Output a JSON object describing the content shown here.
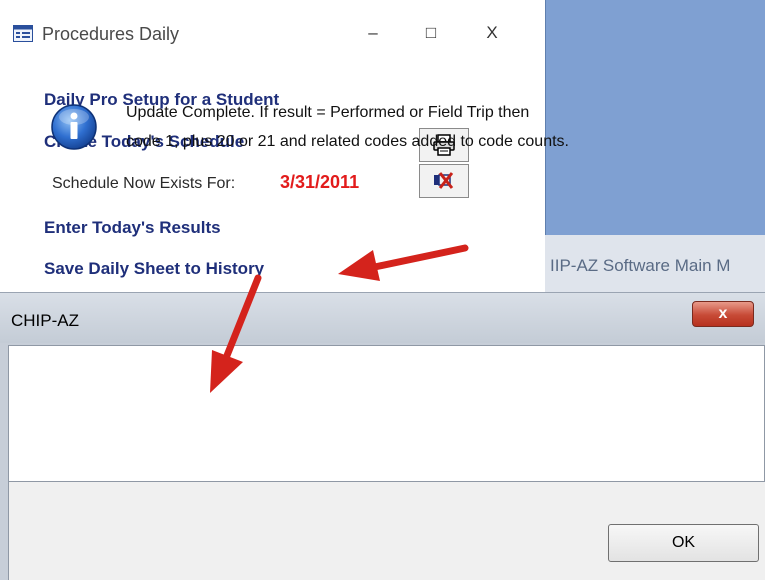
{
  "procedures_window": {
    "title": "Procedures Daily",
    "title_icon": "form-icon",
    "controls": {
      "minimize": "–",
      "maximize": "□",
      "close": "X"
    },
    "links": {
      "setup": "Daily Pro Setup for a Student",
      "create": "Create Today's Schedule",
      "enter": "Enter Today's Results",
      "save": "Save Daily Sheet to History"
    },
    "schedule_label": "Schedule Now Exists For:",
    "schedule_date": "3/31/2011",
    "buttons": [
      {
        "icon": "printer-icon"
      },
      {
        "icon": "delete-schedule-icon"
      }
    ]
  },
  "main_menu": {
    "title": "IIP-AZ Software Main M"
  },
  "dialog": {
    "title": "CHIP-AZ",
    "close_label": "x",
    "icon": "info-icon",
    "message_line_1": "Update Complete. If result = Performed or Field Trip then",
    "message_line_2": "code 1, plus 20 or 21 and related codes added to code counts.",
    "ok_label": "OK"
  },
  "colors": {
    "link": "#1f2f7a",
    "date": "#e21b1b",
    "arrow": "#d4231c",
    "blue_pane": "#7fa0d2"
  }
}
